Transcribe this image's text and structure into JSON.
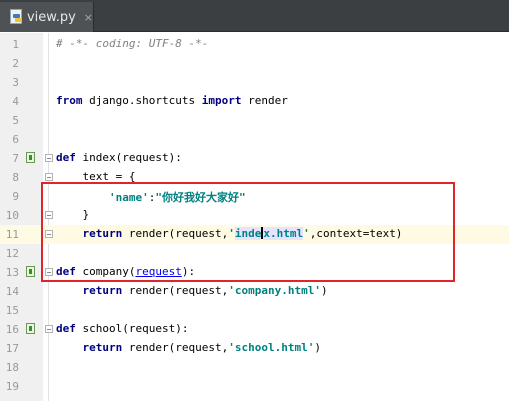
{
  "tab": {
    "label": "view.py",
    "icon": "python-file-icon",
    "close": "×"
  },
  "lines": [
    {
      "n": "1",
      "text": "# -*- coding: UTF-8 -*-"
    },
    {
      "n": "2"
    },
    {
      "n": "3"
    },
    {
      "n": "4",
      "kw": "from",
      "mod": " django.shortcuts ",
      "kw2": "import",
      "rest": " render"
    },
    {
      "n": "5"
    },
    {
      "n": "6"
    },
    {
      "n": "7",
      "kw": "def",
      "rest": " index(request):"
    },
    {
      "n": "8",
      "rest": "    text = {"
    },
    {
      "n": "9",
      "indent": "        ",
      "str1": "'name'",
      "sep": ":",
      "str2": "\"你好我好大家好\""
    },
    {
      "n": "10",
      "rest": "    }"
    },
    {
      "n": "11",
      "indent": "    ",
      "kw": "return",
      "pre": " render(request,",
      "q": "'",
      "sel1": "inde",
      "sel2": "x.html",
      "q2": "'",
      "post": ",context=text)"
    },
    {
      "n": "12"
    },
    {
      "n": "13",
      "kw": "def",
      "pre": " company(",
      "link": "request",
      "post": "):"
    },
    {
      "n": "14",
      "indent": "    ",
      "kw": "return",
      "pre": " render(request,",
      "str": "'company.html'",
      "post": ")"
    },
    {
      "n": "15"
    },
    {
      "n": "16",
      "kw": "def",
      "rest": " school(request):"
    },
    {
      "n": "17",
      "indent": "    ",
      "kw": "return",
      "pre": " render(request,",
      "str": "'school.html'",
      "post": ")"
    },
    {
      "n": "18"
    },
    {
      "n": "19"
    }
  ]
}
